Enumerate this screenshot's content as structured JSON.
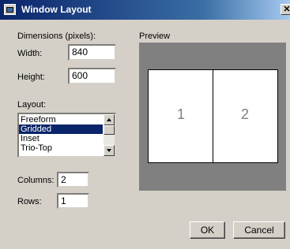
{
  "window": {
    "title": "Window Layout",
    "close_glyph": "✕"
  },
  "dimensions": {
    "heading": "Dimensions (pixels):",
    "width_label": "Width:",
    "width_value": "840",
    "height_label": "Height:",
    "height_value": "600"
  },
  "layout": {
    "label": "Layout:",
    "options": [
      "Freeform",
      "Gridded",
      "Inset",
      "Trio-Top"
    ],
    "selected": "Gridded"
  },
  "grid": {
    "columns_label": "Columns:",
    "columns_value": "2",
    "rows_label": "Rows:",
    "rows_value": "1"
  },
  "preview": {
    "label": "Preview",
    "panes": [
      "1",
      "2"
    ]
  },
  "buttons": {
    "ok": "OK",
    "cancel": "Cancel"
  },
  "colors": {
    "titlebar": "#0a246a",
    "dialog_bg": "#d4d0c8",
    "preview_bg": "#808080",
    "selection": "#0a246a"
  }
}
